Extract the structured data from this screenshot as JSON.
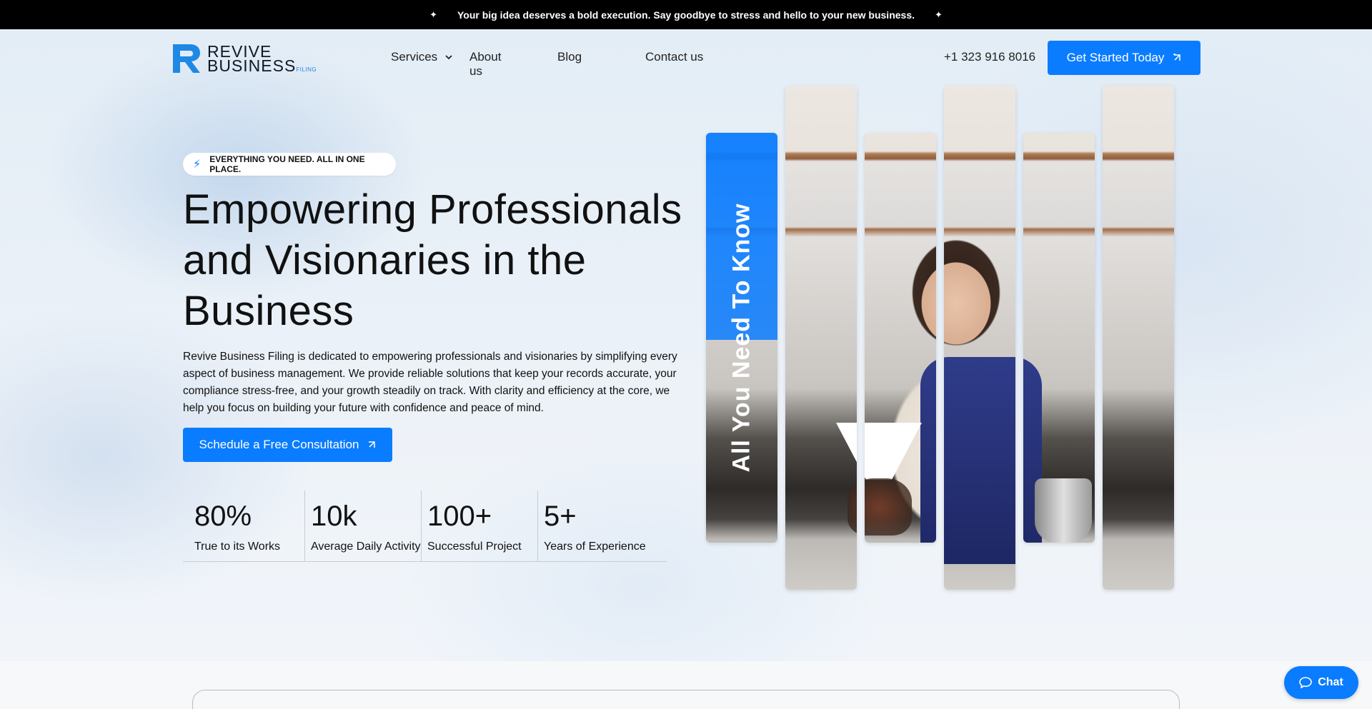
{
  "announcement": {
    "text": "Your big idea deserves a bold execution. Say goodbye to stress and hello to your new business."
  },
  "brand": {
    "line1": "REVIVE",
    "line2": "BUSINESS",
    "line3": "FILING"
  },
  "nav": {
    "services": "Services",
    "about": "About us",
    "blog": "Blog",
    "contact": "Contact us"
  },
  "header": {
    "phone": "+1 323 916 8016",
    "cta": "Get Started Today"
  },
  "hero": {
    "pill": "EVERYTHING YOU NEED. ALL IN ONE PLACE.",
    "headline": "Empowering Professionals and Visionaries in the Business",
    "lead": "Revive Business Filing is dedicated to empowering professionals and visionaries by simplifying every aspect of business management. We provide reliable solutions that keep your records accurate, your compliance stress-free, and your growth steadily on track. With clarity and efficiency at the core, we help you focus on building your future with confidence and peace of mind.",
    "cta": "Schedule a Free Consultation",
    "image_caption": "All You Need To Know"
  },
  "stats": [
    {
      "value": "80%",
      "label": "True to its Works"
    },
    {
      "value": "10k",
      "label": "Average Daily Activity"
    },
    {
      "value": "100+",
      "label": "Successful Project"
    },
    {
      "value": "5+",
      "label": "Years of Experience"
    }
  ],
  "chat": {
    "label": "Chat"
  },
  "colors": {
    "accent": "#0a7cff",
    "announcement_bg": "#000000"
  },
  "icons": [
    "sparkle-icon",
    "chevron-down-icon",
    "arrow-up-right-icon",
    "lightning-icon",
    "chat-bubble-icon"
  ]
}
